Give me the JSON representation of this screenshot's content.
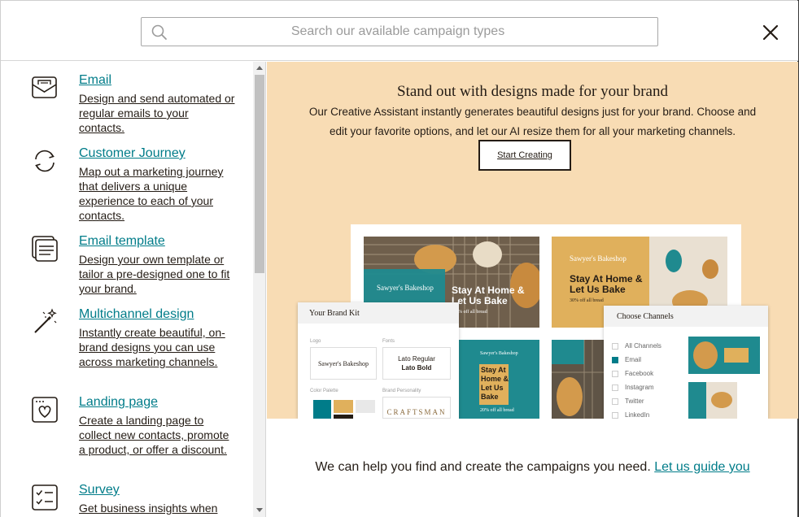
{
  "search": {
    "placeholder": "Search our available campaign types"
  },
  "sidebar": {
    "items": [
      {
        "title": "Email",
        "desc": "Design and send automated or regular emails to your contacts.",
        "icon": "envelope-icon"
      },
      {
        "title": "Customer Journey",
        "desc": "Map out a marketing journey that delivers a unique experience to each of your contacts.",
        "icon": "refresh-cycle-icon"
      },
      {
        "title": "Email template",
        "desc": "Design your own template or tailor a pre-designed one to fit your brand.",
        "icon": "template-icon"
      },
      {
        "title": "Multichannel design",
        "desc": "Instantly create beautiful, on-brand designs you can use across marketing channels.",
        "icon": "magic-wand-icon"
      },
      {
        "title": "Landing page",
        "desc": "Create a landing page to collect new contacts, promote a product, or offer a discount.",
        "icon": "landing-page-heart-icon"
      },
      {
        "title": "Survey",
        "desc": "Get business insights when",
        "icon": "checklist-icon"
      }
    ]
  },
  "hero": {
    "heading": "Stand out with designs made for your brand",
    "body": "Our Creative Assistant instantly generates beautiful designs just for your brand. Choose and edit your favorite options, and let our AI resize them for all your marketing channels.",
    "cta": "Start Creating"
  },
  "preview": {
    "bakeshop": "Sawyer's Bakeshop",
    "headline_a": "Stay At Home & Let Us Bake",
    "headline_b": "Stay At Home & Let Us Bake",
    "headline_c": "Stay At Home & Let Us Bake",
    "sub_a": "20% off all bread",
    "sub_b": "30% off all bread",
    "sub_c": "20% off all bread",
    "brand_kit": {
      "title": "Your Brand Kit",
      "logo_label": "Logo",
      "fonts_label": "Fonts",
      "logo_text": "Sawyer's Bakeshop",
      "font_regular": "Lato Regular",
      "font_bold": "Lato Bold",
      "palette_label": "Color Palette",
      "personality_label": "Brand Personality",
      "personality_value": "CRAFTSMAN"
    },
    "channels": {
      "title": "Choose Channels",
      "items": [
        {
          "label": "All Channels",
          "checked": false
        },
        {
          "label": "Email",
          "checked": true
        },
        {
          "label": "Facebook",
          "checked": false
        },
        {
          "label": "Instagram",
          "checked": false
        },
        {
          "label": "Twitter",
          "checked": false
        },
        {
          "label": "LinkedIn",
          "checked": false
        }
      ]
    }
  },
  "footer": {
    "text": "We can help you find and create the campaigns you need.",
    "link": "Let us guide you"
  },
  "colors": {
    "teal": "#007c89",
    "peach": "#f8dcb4",
    "mustard": "#e0b05c",
    "dark": "#241c15"
  }
}
